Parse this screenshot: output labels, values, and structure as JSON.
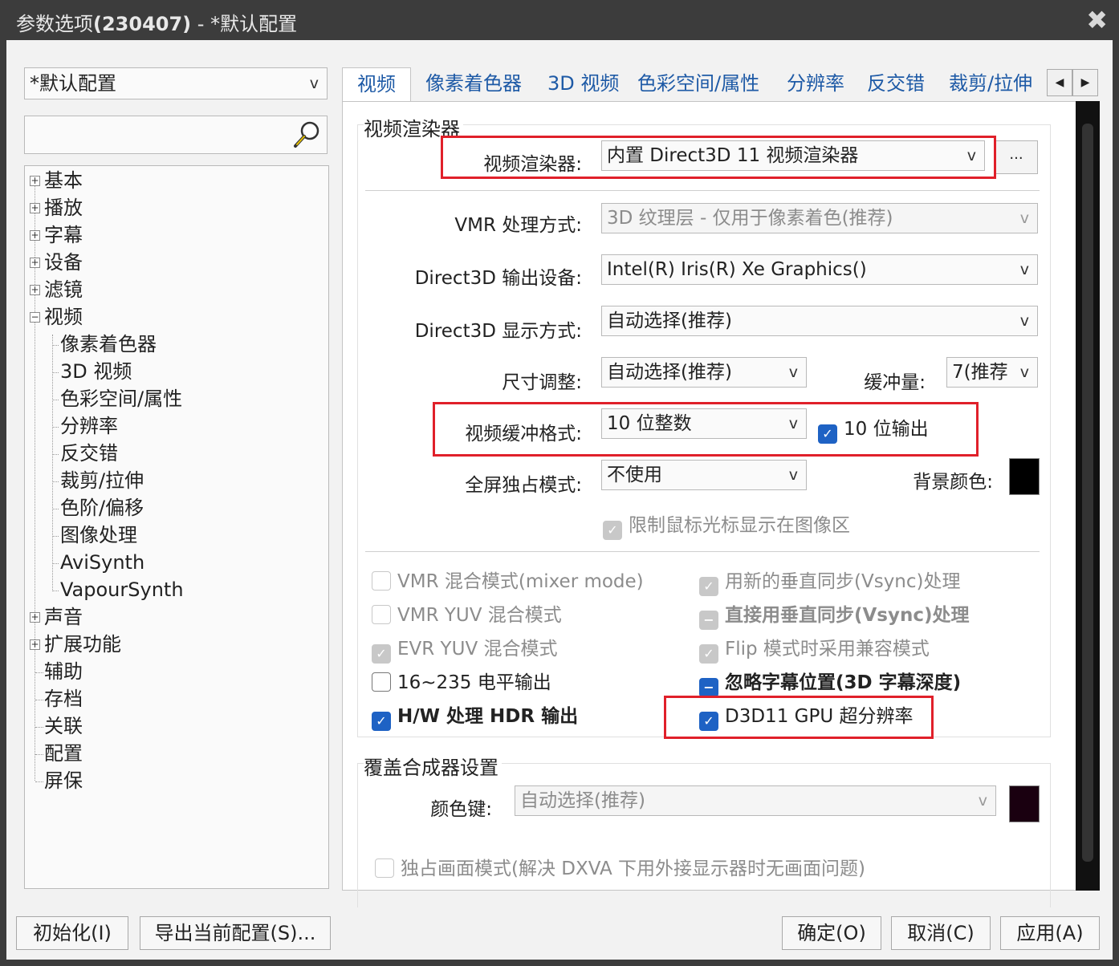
{
  "window": {
    "title_prefix": "参数选项",
    "title_version": "(230407)",
    "title_suffix": "- *默认配置",
    "close_glyph": "✖"
  },
  "sidebar": {
    "profile_value": "*默认配置",
    "search_value": "",
    "tree": [
      {
        "label": "基本",
        "expander": "+"
      },
      {
        "label": "播放",
        "expander": "+"
      },
      {
        "label": "字幕",
        "expander": "+"
      },
      {
        "label": "设备",
        "expander": "+"
      },
      {
        "label": "滤镜",
        "expander": "+"
      },
      {
        "label": "视频",
        "expander": "−"
      },
      {
        "label": "像素着色器"
      },
      {
        "label": "3D 视频"
      },
      {
        "label": "色彩空间/属性"
      },
      {
        "label": "分辨率"
      },
      {
        "label": "反交错"
      },
      {
        "label": "裁剪/拉伸"
      },
      {
        "label": "色阶/偏移"
      },
      {
        "label": "图像处理"
      },
      {
        "label": "AviSynth"
      },
      {
        "label": "VapourSynth"
      },
      {
        "label": "声音",
        "expander": "+"
      },
      {
        "label": "扩展功能",
        "expander": "+"
      },
      {
        "label": "辅助"
      },
      {
        "label": "存档"
      },
      {
        "label": "关联"
      },
      {
        "label": "配置"
      },
      {
        "label": "屏保"
      }
    ]
  },
  "tabs": [
    "视频",
    "像素着色器",
    "3D 视频",
    "色彩空间/属性",
    "分辨率",
    "反交错",
    "裁剪/拉伸"
  ],
  "tab_scroll": {
    "left": "◀",
    "right": "▶"
  },
  "renderer_group": {
    "title": "视频渲染器",
    "renderer_label": "视频渲染器:",
    "renderer_value": "内置 Direct3D 11 视频渲染器",
    "more_button": "...",
    "vmr_label": "VMR 处理方式:",
    "vmr_value": "3D 纹理层 - 仅用于像素着色(推荐)",
    "d3d_device_label": "Direct3D 输出设备:",
    "d3d_device_value": "Intel(R) Iris(R) Xe Graphics()",
    "d3d_display_label": "Direct3D 显示方式:",
    "d3d_display_value": "自动选择(推荐)",
    "resize_label": "尺寸调整:",
    "resize_value": "自动选择(推荐)",
    "buffer_label": "缓冲量:",
    "buffer_value": "7(推荐",
    "buffer_format_label": "视频缓冲格式:",
    "buffer_format_value": "10 位整数",
    "ten_bit_output": "10 位输出",
    "fullscreen_label": "全屏独占模式:",
    "fullscreen_value": "不使用",
    "bg_color_label": "背景颜色:",
    "bg_color": "#000000",
    "limit_cursor": "限制鼠标光标显示在图像区",
    "options": [
      {
        "label": "VMR 混合模式(mixer mode)",
        "state": "dis-off"
      },
      {
        "label": "用新的垂直同步(Vsync)处理",
        "state": "dis-on"
      },
      {
        "label": "VMR YUV 混合模式",
        "state": "dis-off"
      },
      {
        "label": "直接用垂直同步(Vsync)处理",
        "state": "dis-ind"
      },
      {
        "label": "EVR YUV 混合模式",
        "state": "dis-on"
      },
      {
        "label": "Flip 模式时采用兼容模式",
        "state": "dis-on"
      },
      {
        "label": "16~235 电平输出",
        "state": "off"
      },
      {
        "label": "忽略字幕位置(3D 字幕深度)",
        "state": "ind"
      },
      {
        "label": "H/W 处理 HDR 输出",
        "state": "on"
      },
      {
        "label": "D3D11 GPU 超分辨率",
        "state": "on"
      }
    ]
  },
  "overlay_group": {
    "title": "覆盖合成器设置",
    "colorkey_label": "颜色键:",
    "colorkey_value": "自动选择(推荐)",
    "colorkey_color": "#1a0010",
    "exclusive_mode": "独占画面模式(解决 DXVA 下用外接显示器时无画面问题)"
  },
  "footer": {
    "init": "初始化(I)",
    "export": "导出当前配置(S)...",
    "ok": "确定(O)",
    "cancel": "取消(C)",
    "apply": "应用(A)"
  },
  "colors": {
    "highlight": "#e0202a",
    "accent": "#1e62c4",
    "titlebar": "#3c3c3c"
  },
  "arrow_glyph": "v",
  "check_glyph": "✓",
  "indeterminate_glyph": "−"
}
